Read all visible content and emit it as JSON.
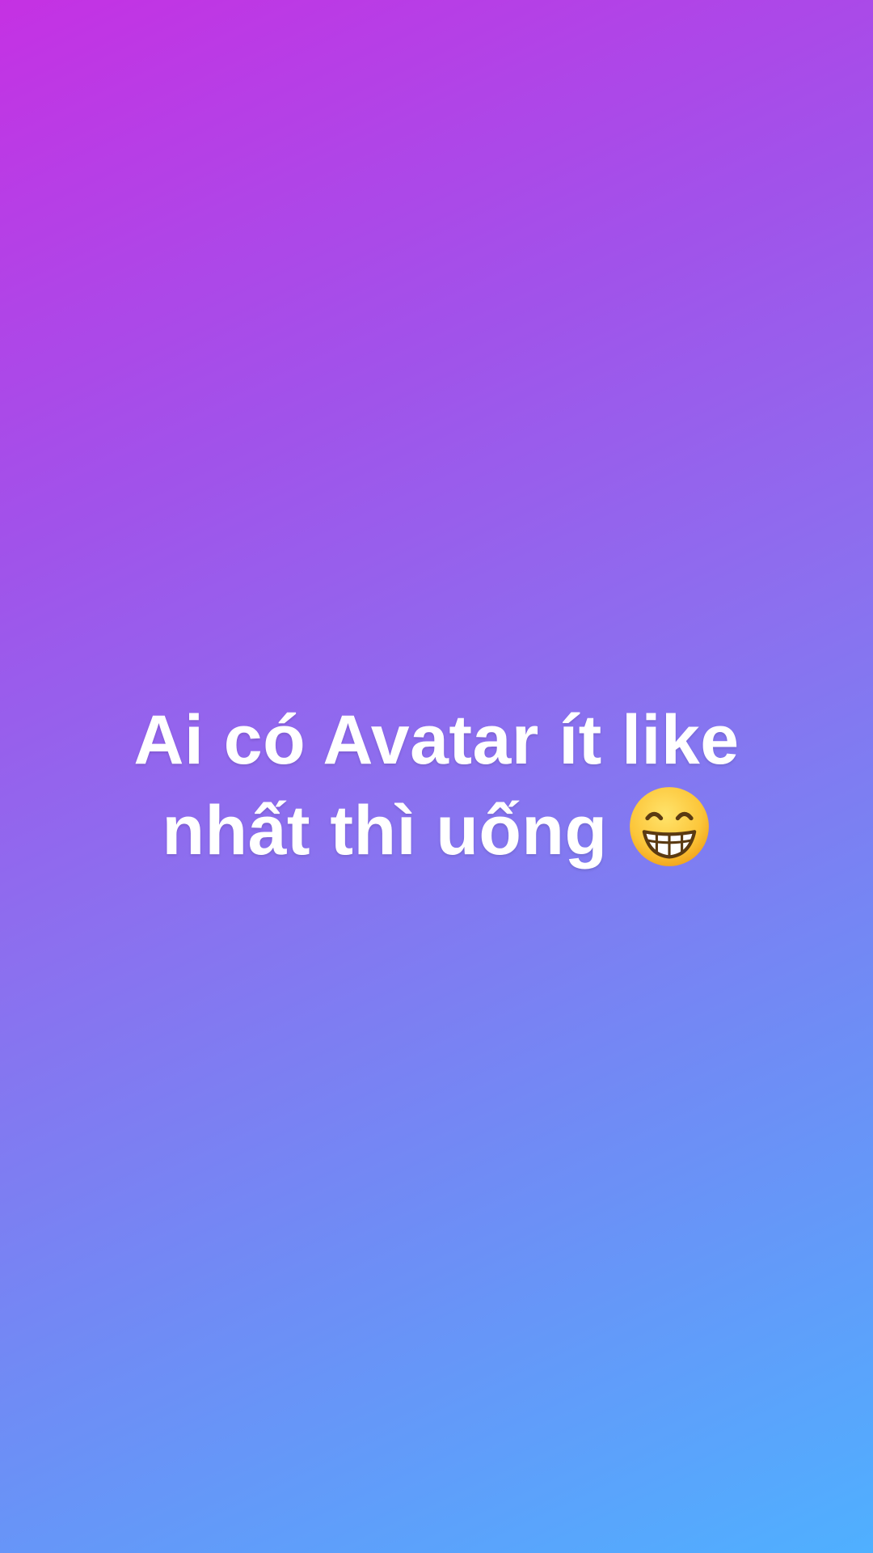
{
  "story": {
    "line1": "Ai có Avatar ít like",
    "line2": "nhất thì uống",
    "emoji_icon": "grinning-face-with-smiling-eyes-icon",
    "gradient_colors": [
      "#c531e3",
      "#a152ea",
      "#8b70ef",
      "#6f8cf5",
      "#4fb0ff"
    ],
    "text_color": "#ffffff"
  }
}
